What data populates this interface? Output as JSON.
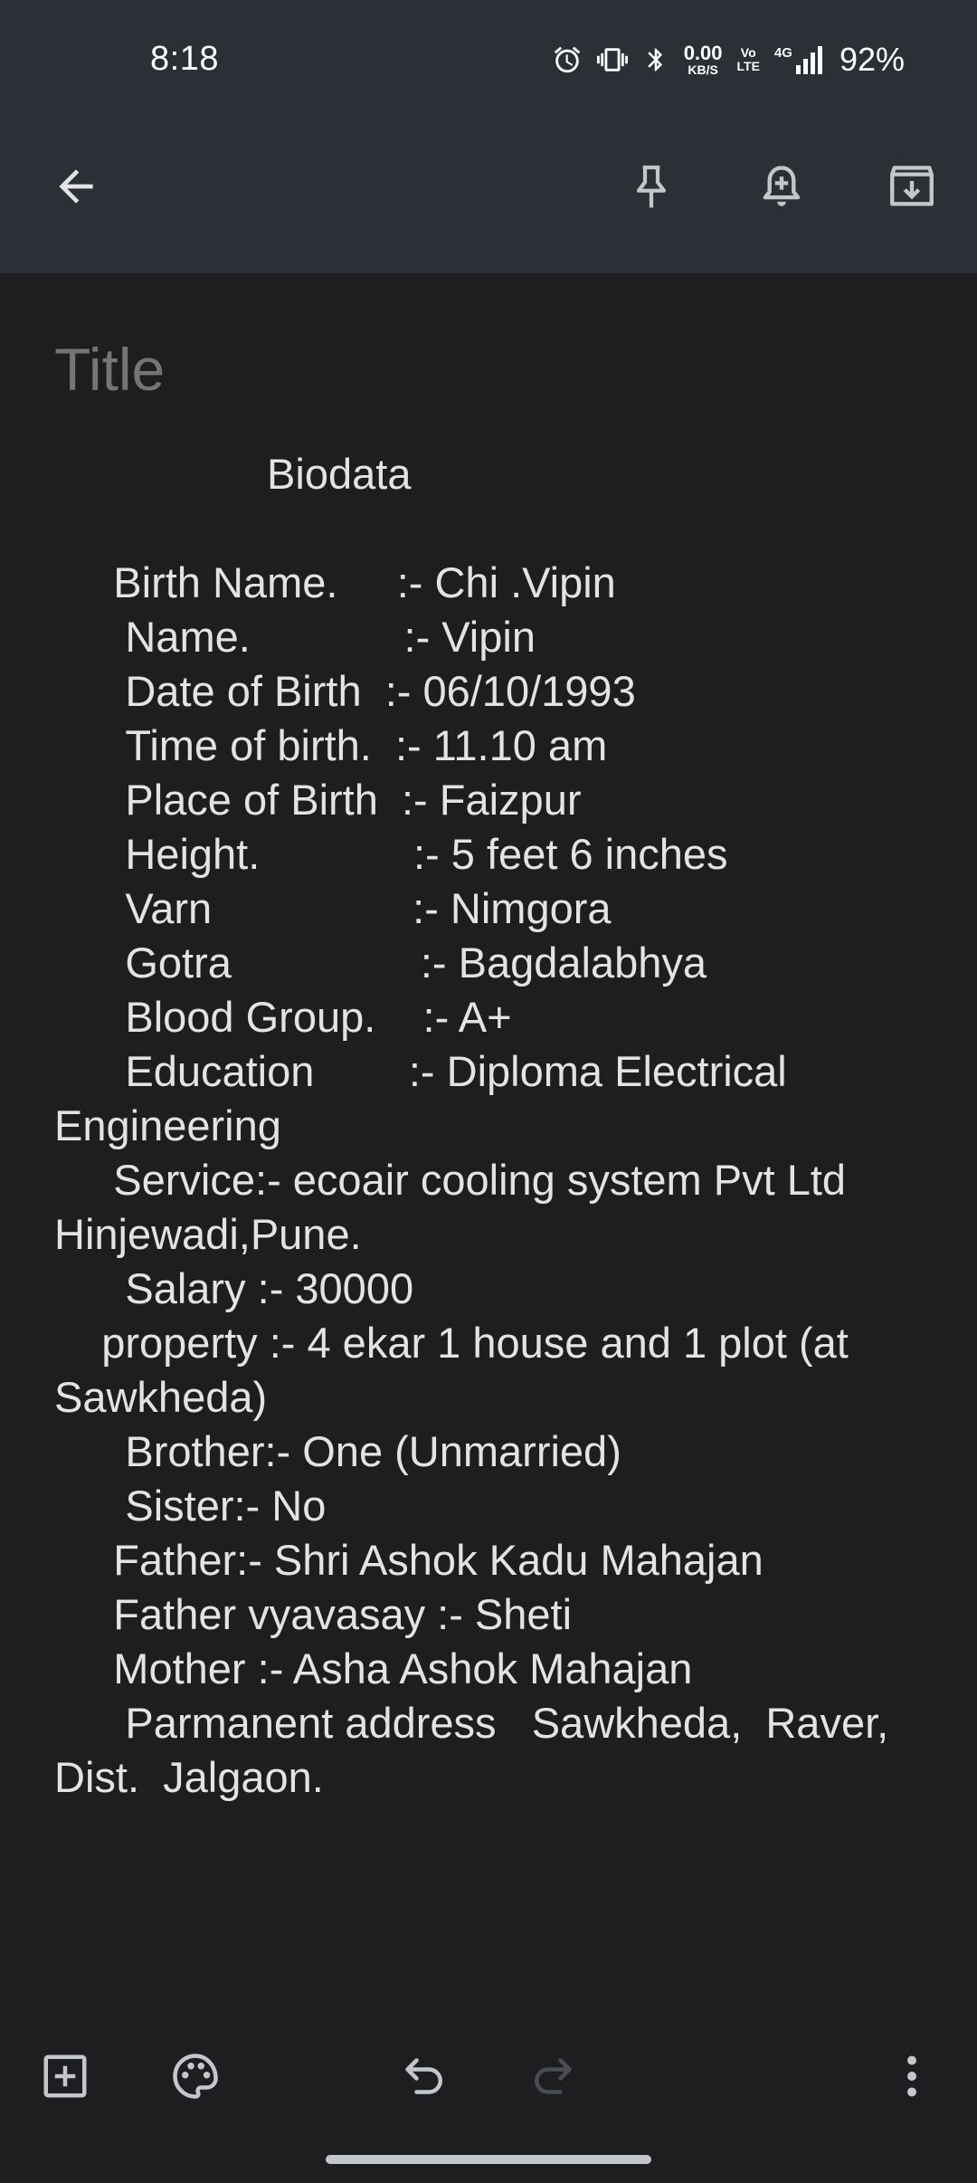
{
  "status_bar": {
    "time": "8:18",
    "net_speed_value": "0.00",
    "net_speed_unit": "KB/S",
    "volte_top": "Vo",
    "volte_bottom": "LTE",
    "network_type": "4G",
    "battery": "92%"
  },
  "app_bar": {
    "icons": [
      "back-arrow-icon",
      "pin-icon",
      "add-reminder-icon",
      "archive-icon"
    ]
  },
  "note": {
    "title_placeholder": "Title",
    "title_value": "",
    "body": "                  Biodata\n\n     Birth Name.     :- Chi .Vipin\n      Name.             :- Vipin\n      Date of Birth  :- 06/10/1993\n      Time of birth.  :- 11.10 am\n      Place of Birth  :- Faizpur\n      Height.             :- 5 feet 6 inches\n      Varn                 :- Nimgora\n      Gotra                :- Bagdalabhya\n      Blood Group.    :- A+\n      Education        :- Diploma Electrical Engineering\n     Service:- ecoair cooling system Pvt Ltd Hinjewadi,Pune.\n      Salary :- 30000\n    property :- 4 ekar 1 house and 1 plot (at Sawkheda)\n      Brother:- One (Unmarried)\n      Sister:- No\n     Father:- Shri Ashok Kadu Mahajan\n     Father vyavasay :- Sheti\n     Mother :- Asha Ashok Mahajan\n      Parmanent address   Sawkheda,  Raver, Dist.  Jalgaon."
  },
  "bottom_bar": {
    "icons": [
      "add-box-icon",
      "palette-icon",
      "undo-icon",
      "redo-icon",
      "more-vert-icon"
    ],
    "redo_enabled": false
  },
  "colors": {
    "background": "#1c1e20",
    "top_bar": "#2a3035",
    "text": "#e3e3e3",
    "placeholder": "#8a8c8f",
    "icon": "#c4c7c9",
    "disabled_icon": "#55595d"
  }
}
